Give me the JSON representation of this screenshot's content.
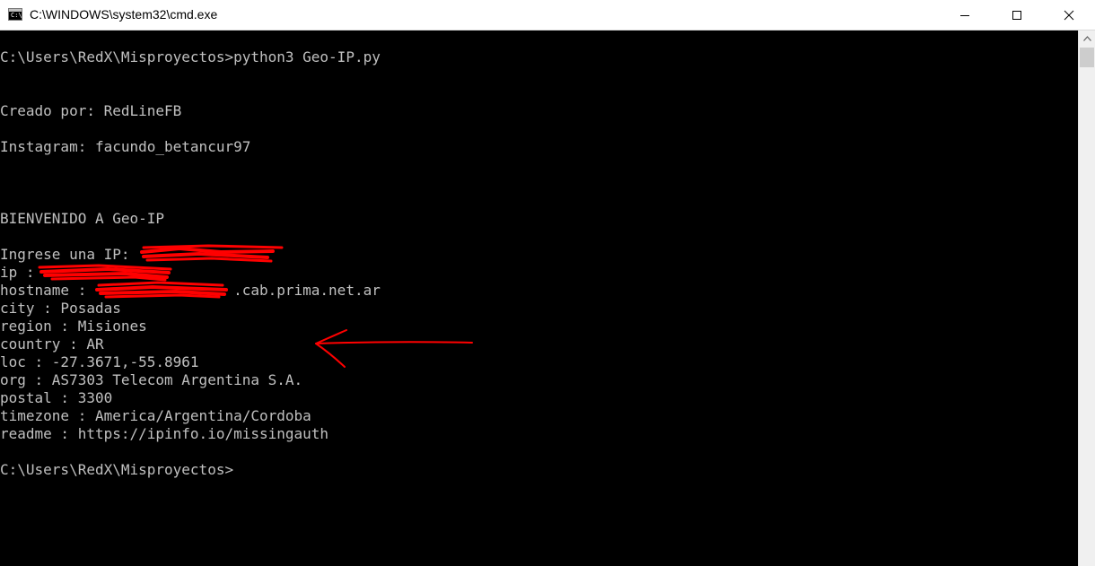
{
  "window": {
    "title": "C:\\WINDOWS\\system32\\cmd.exe",
    "icon": "cmd-icon",
    "controls": [
      "minimize-icon",
      "maximize-icon",
      "close-icon"
    ]
  },
  "console": {
    "lines": [
      "C:\\Users\\RedX\\Misproyectos>python3 Geo-IP.py",
      "Creado por: RedLineFB",
      "Instagram: facundo_betancur97",
      "BIENVENIDO A Geo-IP",
      "Ingrese una IP: ",
      "ip : ",
      "hostname :                 .cab.prima.net.ar",
      "city : Posadas",
      "region : Misiones",
      "country : AR",
      "loc : -27.3671,-55.8961",
      "org : AS7303 Telecom Argentina S.A.",
      "postal : 3300",
      "timezone : America/Argentina/Cordoba",
      "readme : https://ipinfo.io/missingauth",
      "C:\\Users\\RedX\\Misproyectos>"
    ]
  },
  "annotations": {
    "scribble_color": "#ff0000",
    "arrow_color": "#ff0000"
  }
}
